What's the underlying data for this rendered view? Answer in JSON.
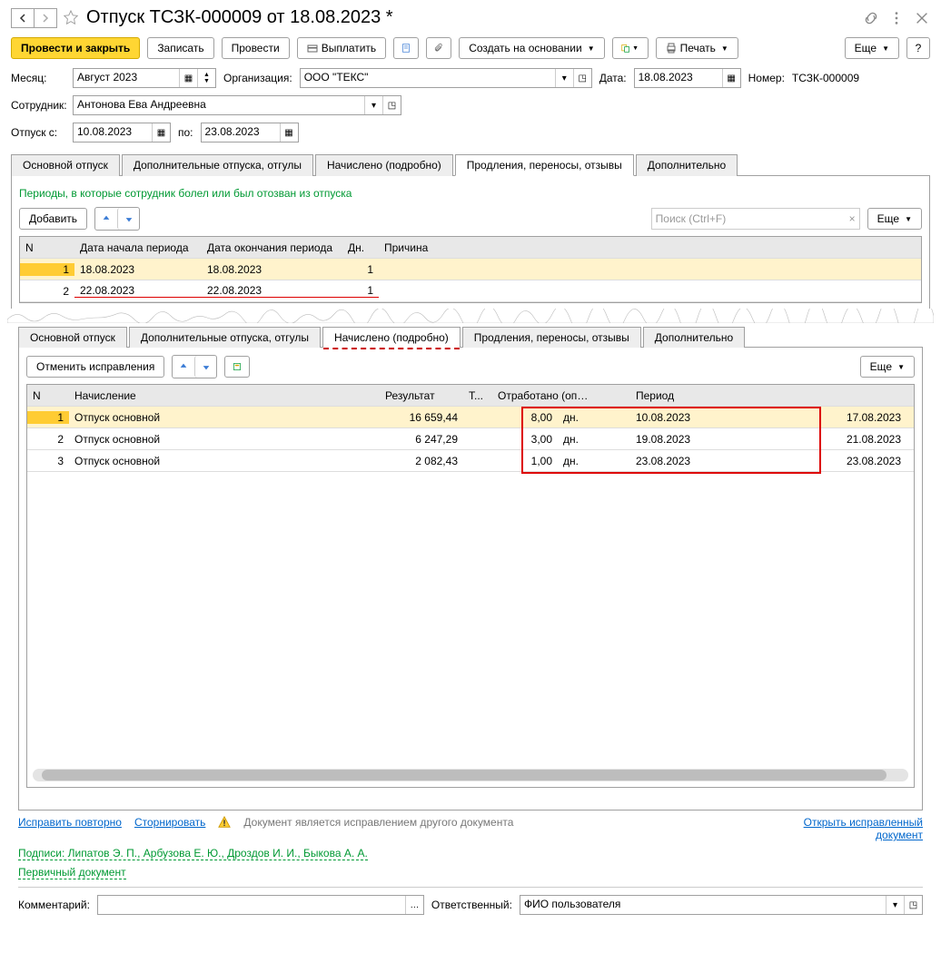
{
  "title": "Отпуск ТСЗК-000009 от 18.08.2023 *",
  "toolbar": {
    "post_close": "Провести и закрыть",
    "save": "Записать",
    "post": "Провести",
    "pay": "Выплатить",
    "create_based": "Создать на основании",
    "print": "Печать",
    "more": "Еще"
  },
  "fields": {
    "month_lbl": "Месяц:",
    "month_val": "Август 2023",
    "org_lbl": "Организация:",
    "org_val": "ООО \"ТЕКС\"",
    "date_lbl": "Дата:",
    "date_val": "18.08.2023",
    "num_lbl": "Номер:",
    "num_val": "ТСЗК-000009",
    "emp_lbl": "Сотрудник:",
    "emp_val": "Антонова Ева Андреевна",
    "from_lbl": "Отпуск с:",
    "from_val": "10.08.2023",
    "to_lbl": "по:",
    "to_val": "23.08.2023"
  },
  "tabs1": [
    "Основной отпуск",
    "Дополнительные отпуска, отгулы",
    "Начислено (подробно)",
    "Продления, переносы, отзывы",
    "Дополнительно"
  ],
  "tab1_active": 3,
  "section_msg": "Периоды, в которые сотрудник болел или был отозван из отпуска",
  "add_btn": "Добавить",
  "search_ph": "Поиск (Ctrl+F)",
  "grid1_cols": [
    "N",
    "Дата начала периода",
    "Дата окончания периода",
    "Дн.",
    "Причина"
  ],
  "grid1_rows": [
    {
      "n": "1",
      "start": "18.08.2023",
      "end": "18.08.2023",
      "days": "1",
      "reason": ""
    },
    {
      "n": "2",
      "start": "22.08.2023",
      "end": "22.08.2023",
      "days": "1",
      "reason": ""
    }
  ],
  "tabs2": [
    "Основной отпуск",
    "Дополнительные отпуска, отгулы",
    "Начислено (подробно)",
    "Продления, переносы, отзывы",
    "Дополнительно"
  ],
  "tab2_active": 2,
  "cancel_fix": "Отменить исправления",
  "grid2_cols": [
    "N",
    "Начисление",
    "Результат",
    "Т...",
    "Отработано (опл...",
    "",
    "Период",
    ""
  ],
  "grid2_rows": [
    {
      "n": "1",
      "name": "Отпуск основной",
      "res": "16 659,44",
      "wrk": "8,00",
      "u": "дн.",
      "pfrom": "10.08.2023",
      "pto": "17.08.2023"
    },
    {
      "n": "2",
      "name": "Отпуск основной",
      "res": "6 247,29",
      "wrk": "3,00",
      "u": "дн.",
      "pfrom": "19.08.2023",
      "pto": "21.08.2023"
    },
    {
      "n": "3",
      "name": "Отпуск основной",
      "res": "2 082,43",
      "wrk": "1,00",
      "u": "дн.",
      "pfrom": "23.08.2023",
      "pto": "23.08.2023"
    }
  ],
  "footer": {
    "fix_again": "Исправить повторно",
    "storno": "Сторнировать",
    "warn": "Документ является исправлением другого документа",
    "open_fixed": "Открыть исправленный документ",
    "signs": "Подписи: Липатов Э. П., Арбузова Е. Ю., Дроздов И. И., Быкова А. А.",
    "primary_doc": "Первичный документ",
    "comment_lbl": "Комментарий:",
    "resp_lbl": "Ответственный:",
    "resp_val": "ФИО пользователя"
  }
}
